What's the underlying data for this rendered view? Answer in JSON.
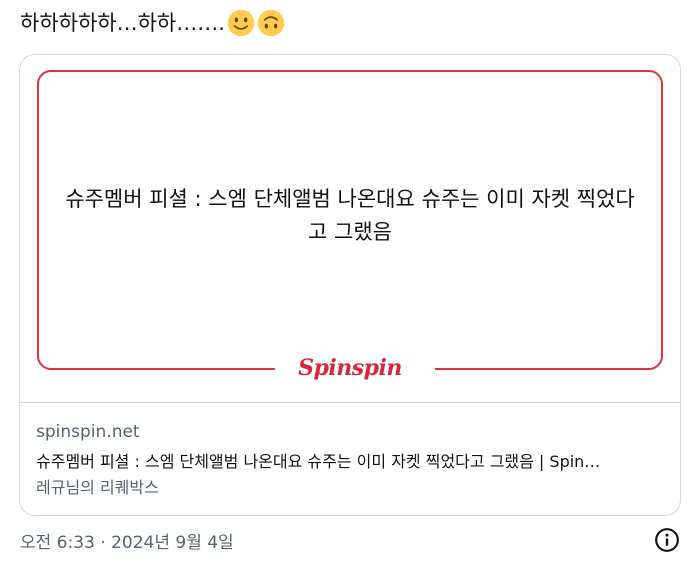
{
  "tweet": {
    "text": "하하하하하…하하…….",
    "emojis": [
      "slightly-smiling-face-icon",
      "upside-down-face-icon"
    ]
  },
  "card": {
    "media_title": "슈주멤버 피셜 : 스엠 단체앨범 나온대요 슈주는 이미 자켓 찍었다고 그랬음",
    "logo_text": "Spinspin",
    "domain": "spinspin.net",
    "title": "슈주멤버 피셜 : 스엠 단체앨범 나온대요 슈주는 이미 자켓 찍었다고 그랬음 | Spin…",
    "description": "레규님의 리퀘박스",
    "accent_color": "#e0313f"
  },
  "meta": {
    "timestamp": "오전 6:33 · 2024년 9월 4일"
  }
}
